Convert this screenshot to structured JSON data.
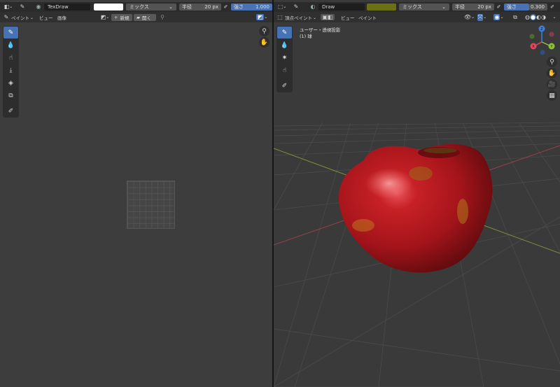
{
  "image_editor": {
    "mode_icon": "image-editor-icon",
    "brush_icon": "brush-icon",
    "brush_name": "TexDraw",
    "blend_mode": "ミックス",
    "radius_label": "半径",
    "radius_value": "20 px",
    "strength_label": "強さ",
    "strength_value": "1.000",
    "menus": [
      "ペイント",
      "ビュー",
      "画像"
    ],
    "new_label": "新規",
    "open_label": "開く"
  },
  "viewport": {
    "mode_label": "頂点ペイント",
    "brush_name": "Draw",
    "brush_color": "#6b7012",
    "blend_mode": "ミックス",
    "radius_label": "半径",
    "radius_value": "20 px",
    "strength_label": "強さ",
    "strength_value": "0.300",
    "menus": [
      "ビュー",
      "ペイント"
    ],
    "view_label": "ユーザー・透視投影",
    "object_label": "(1) 球"
  },
  "colors": {
    "accent": "#4772b3",
    "axis_x": "#e04a5a",
    "axis_y": "#88c43a",
    "axis_z": "#3c7fe0"
  }
}
